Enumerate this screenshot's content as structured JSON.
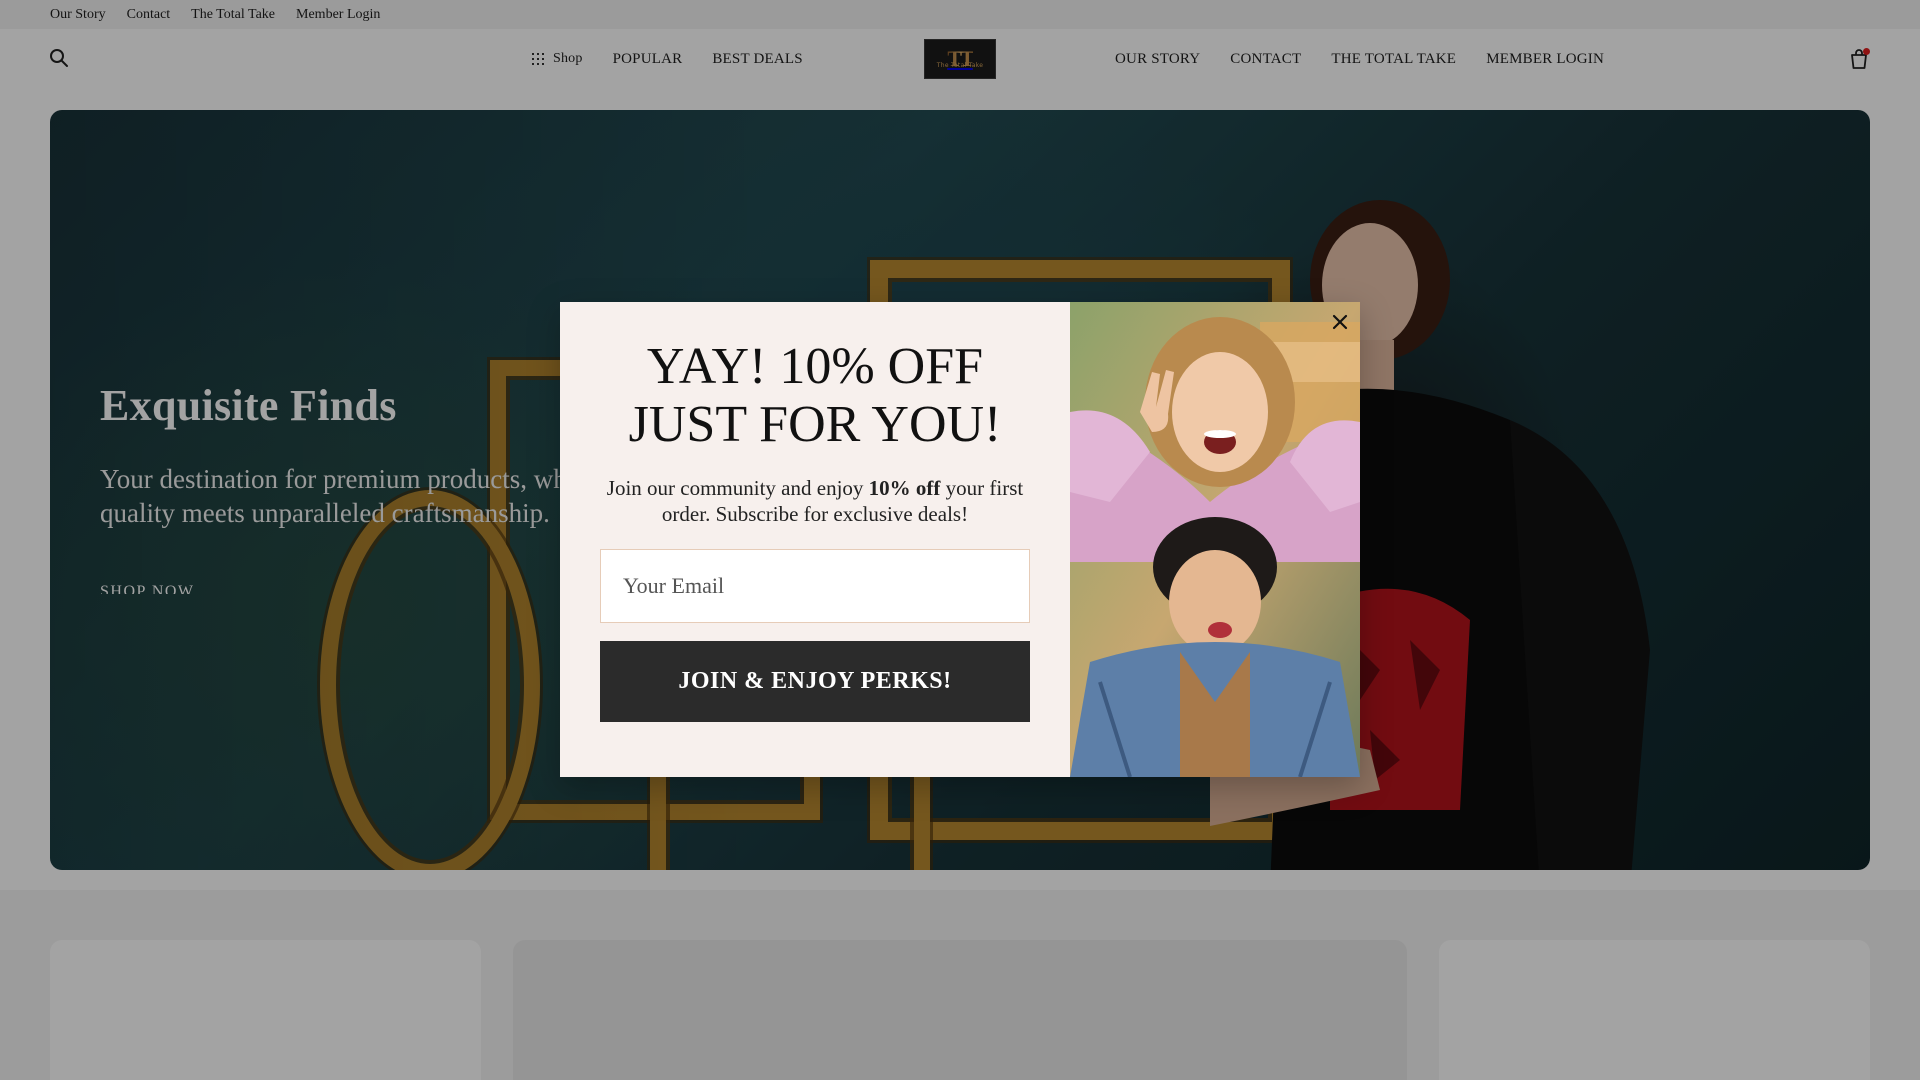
{
  "topbar": {
    "links": [
      "Our Story",
      "Contact",
      "The Total Take",
      "Member Login"
    ]
  },
  "header": {
    "search_icon": "search-icon",
    "nav_left": {
      "shop": "Shop",
      "popular": "POPULAR",
      "best_deals": "BEST DEALS"
    },
    "logo": {
      "mark": "TT",
      "sub": "The Total Take"
    },
    "nav_right": {
      "our_story": "OUR STORY",
      "contact": "CONTACT",
      "total_take": "THE TOTAL TAKE",
      "member_login": "MEMBER LOGIN"
    },
    "cart_icon": "shopping-bag-icon"
  },
  "hero": {
    "title": "Exquisite Finds",
    "subtitle": "Your destination for premium products, where quality meets unparalleled craftsmanship.",
    "cta": "SHOP NOW"
  },
  "popup": {
    "title_line1": "YAY! 10% OFF",
    "title_line2": "JUST FOR YOU!",
    "text_before": "Join our community and enjoy ",
    "text_bold": "10% off",
    "text_after": " your first order. Subscribe for exclusive deals!",
    "email_placeholder": "Your Email",
    "button_label": "JOIN & ENJOY PERKS!",
    "close_icon": "close-icon"
  },
  "colors": {
    "popup_bg": "#f7f0ed",
    "button_bg": "#2b2b2b",
    "cart_badge": "#e02020",
    "overlay": "rgba(0,0,0,0.36)"
  }
}
